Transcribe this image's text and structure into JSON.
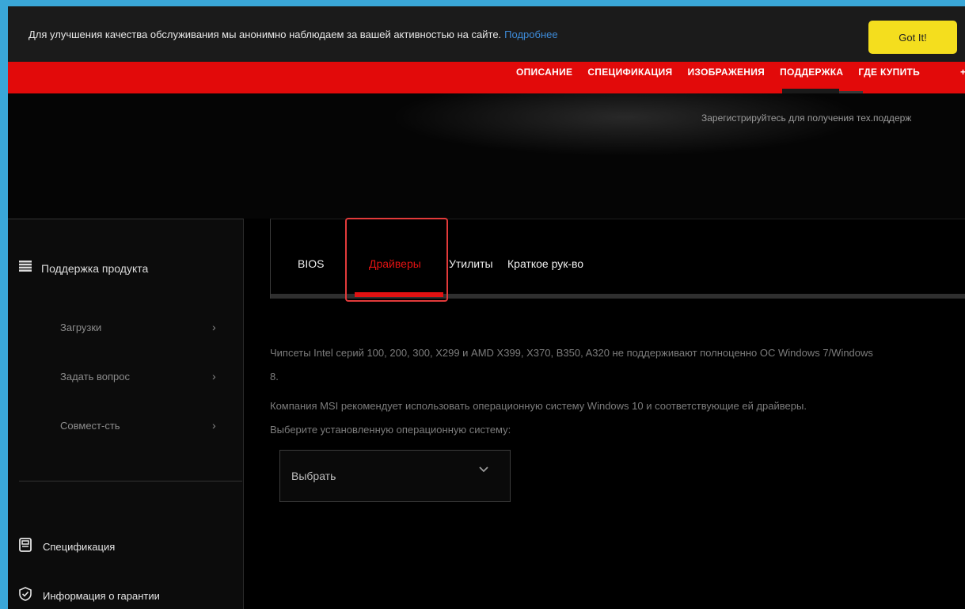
{
  "cookie_bar": {
    "text": "Для улучшения качества обслуживания мы анонимно наблюдаем за вашей активностью на сайте.",
    "link": "Подробнее",
    "button": "Got It!"
  },
  "nav": {
    "items": [
      "ОПИСАНИЕ",
      "СПЕЦИФИКАЦИЯ",
      "ИЗОБРАЖЕНИЯ",
      "ПОДДЕРЖКА",
      "ГДЕ КУПИТЬ"
    ],
    "active": "ПОДДЕРЖКА"
  },
  "hero": {
    "register_text": "Зарегистрируйтесь для получения тех.поддерж"
  },
  "sidebar": {
    "header": "Поддержка продукта",
    "items": [
      {
        "label": "Загрузки"
      },
      {
        "label": "Задать вопрос"
      },
      {
        "label": "Совмест-сть"
      }
    ],
    "links": [
      {
        "label": "Спецификация",
        "icon": "spec-document-icon"
      },
      {
        "label": "Информация о гарантии",
        "icon": "shield-check-icon"
      }
    ]
  },
  "tabs": {
    "items": [
      "BIOS",
      "Драйверы",
      "Утилиты",
      "Краткое рук-во"
    ],
    "active": "Драйверы"
  },
  "info": {
    "line1": "Чипсеты Intel серий 100, 200, 300, X299 и AMD X399, X370, B350, A320 не поддерживают полноценно ОС Windows 7/Windows",
    "line2": "8.",
    "line3": "Компания MSI рекомендует использовать операционную систему Windows 10 и соответствующие ей драйверы.",
    "line4": "Выберите установленную операционную систему:"
  },
  "os_select": {
    "value": "Выбрать"
  },
  "colors": {
    "accent_red": "#e20a0a",
    "got_it_yellow": "#f4de1e",
    "link_blue": "#3d8bd9",
    "background": "#000000"
  }
}
